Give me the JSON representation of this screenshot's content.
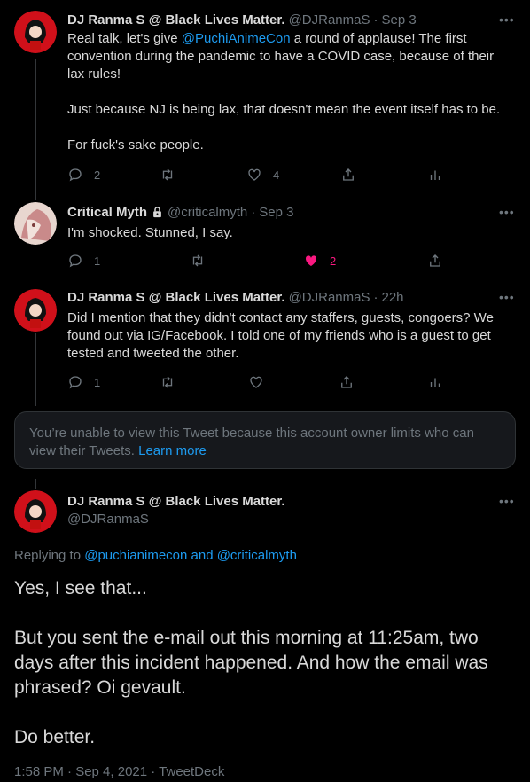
{
  "tweets": [
    {
      "name": "DJ Ranma S @ Black Lives Matter.",
      "handle": "@DJRanmaS",
      "sep": "·",
      "time": "Sep 3",
      "text_prefix": "Real talk, let's give ",
      "mention": "@PuchiAnimeCon",
      "text_rest": " a round of applause! The first convention during the pandemic to have a COVID case, because of their lax rules!\n\nJust because NJ is being lax, that doesn't mean the event itself has to be.\n\nFor fuck's sake people.",
      "replies": "2",
      "retweets": "",
      "likes": "4"
    },
    {
      "name": "Critical Myth",
      "handle": "@criticalmyth",
      "sep": "·",
      "time": "Sep 3",
      "text": "I'm shocked.  Stunned, I say.",
      "replies": "1",
      "retweets": "",
      "likes": "2"
    },
    {
      "name": "DJ Ranma S @ Black Lives Matter.",
      "handle": "@DJRanmaS",
      "sep": "·",
      "time": "22h",
      "text": "Did I mention that they didn't contact any staffers, guests, congoers? We found out via IG/Facebook. I told one of my friends who is a guest to get tested and tweeted the other.",
      "replies": "1",
      "retweets": "",
      "likes": ""
    }
  ],
  "notice": {
    "text": "You’re unable to view this Tweet because this account owner limits who can view their Tweets. ",
    "link": "Learn more"
  },
  "main_tweet": {
    "name": "DJ Ranma S @ Black Lives Matter.",
    "handle": "@DJRanmaS",
    "replying_label": "Replying to ",
    "replying_to": "@puchianimecon and @criticalmyth",
    "text": "Yes, I see that...\n\nBut you sent the e-mail out this morning at 11:25am, two days after this incident happened. And how the email was phrased? Oi gevault.\n\nDo better.",
    "timestamp": "1:58 PM · Sep 4, 2021 · TweetDeck"
  },
  "more_label": "•••",
  "colors": {
    "accent": "#1d9bf0",
    "like": "#f91880",
    "muted": "#6e767d"
  }
}
